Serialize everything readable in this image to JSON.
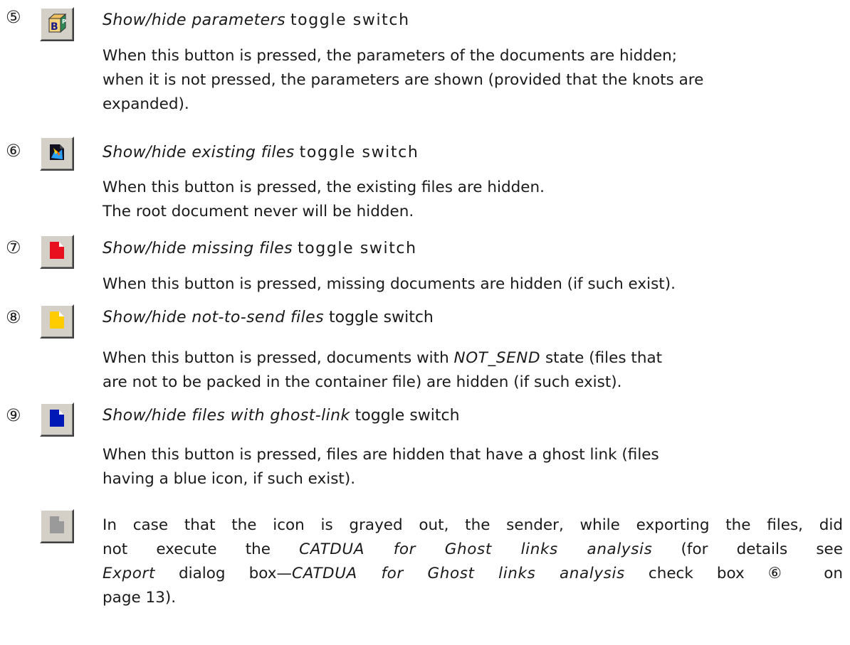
{
  "colors": {
    "button_face": "#d4d0c8",
    "missing_icon": "#e8101e",
    "not_send_icon": "#ffcc00",
    "ghost_icon": "#0019b6",
    "grayed_icon": "#9a9a9a"
  },
  "items": [
    {
      "number": "⑤",
      "icon": "3d-parameter-box-icon",
      "title": "Show/hide parameters",
      "suffix": "toggle switch",
      "lines": [
        "When this button is pressed, the parameters of the documents are hidden;",
        "when it is not pressed, the parameters are shown (provided that the knots are",
        "expanded)."
      ]
    },
    {
      "number": "⑥",
      "icon": "existing-file-icon",
      "title": "Show/hide existing files",
      "suffix": "toggle switch",
      "lines": [
        "When this button is pressed, the existing files are hidden.",
        "The root document never will be hidden."
      ]
    },
    {
      "number": "⑦",
      "icon": "missing-file-red-icon",
      "title": "Show/hide missing files",
      "suffix": "toggle switch",
      "lines": [
        "When this button is pressed, missing documents are hidden (if such exist)."
      ]
    },
    {
      "number": "⑧",
      "icon": "not-to-send-file-yellow-icon",
      "title": "Show/hide not-to-send files",
      "suffix": "toggle switch",
      "lines_rich": {
        "a": "When this button is pressed, documents with ",
        "code": "NOT_SEND",
        "b": " state (files that",
        "line2": "are not to be packed in the container file) are hidden (if such exist)."
      }
    },
    {
      "number": "⑨",
      "icon": "ghost-link-file-blue-icon",
      "title": "Show/hide files with ghost-link",
      "suffix": "toggle switch",
      "lines": [
        "When this button is pressed, files are hidden that have a ghost link (files",
        "having a blue icon, if such exist)."
      ]
    }
  ],
  "note": {
    "icon": "grayed-file-icon",
    "l1": "In case that the icon is grayed out, the sender, while exporting the files, did",
    "l2a": "not execute the ",
    "l2b": "CATDUA for Ghost links analysis",
    "l2c": " (for details see",
    "l3a": "Export",
    "l3b": " dialog box—",
    "l3c": "CATDUA for Ghost links analysis",
    "l3d": " check box ⑥ on",
    "l4": "page 13)."
  }
}
